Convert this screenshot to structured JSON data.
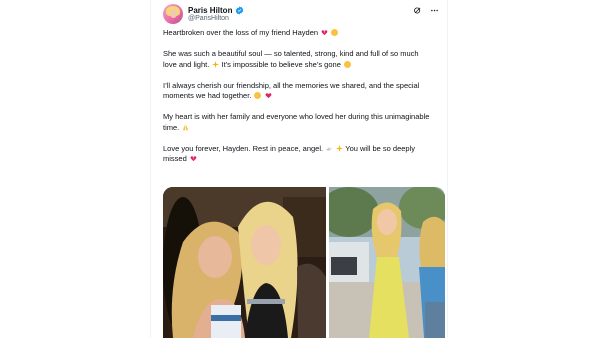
{
  "post": {
    "author_name": "Paris Hilton",
    "author_handle": "@ParisHilton",
    "verified": true,
    "paragraphs": [
      "Heartbroken over the loss of my friend Hayden",
      "She was such a beautiful soul — so talented, strong, kind and full of so much love and light.",
      "It’s impossible to believe she’s gone",
      "I’ll always cherish our friendship, all the memories we shared, and the special moments we had together.",
      "My heart is with her family and everyone who loved her during this unimaginable time.",
      "Love you forever, Hayden. Rest in peace, angel.",
      "You will be so deeply missed"
    ]
  },
  "icons": {
    "avatar": "avatar",
    "verified": "verified-badge-icon",
    "grok": "grok-icon",
    "more": "more-icon"
  },
  "colors": {
    "text": "#0f1419",
    "muted": "#536471",
    "verified": "#1d9bf0"
  }
}
